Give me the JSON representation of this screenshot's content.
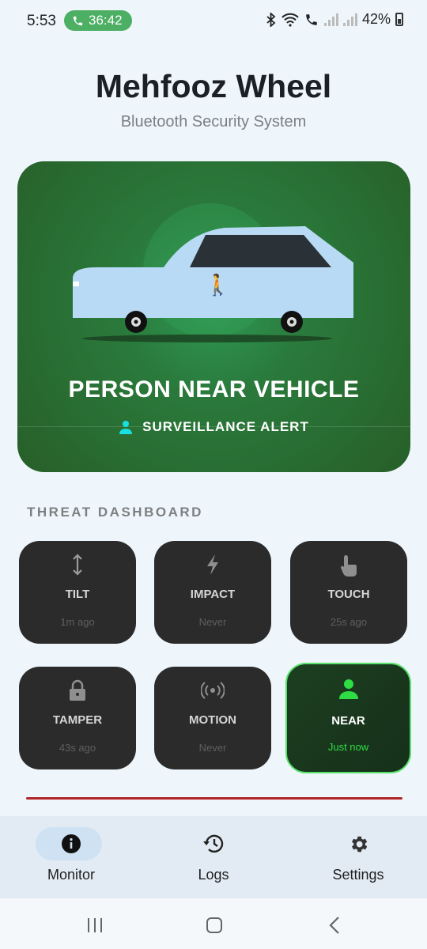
{
  "status_bar": {
    "time": "5:53",
    "call_timer": "36:42",
    "battery": "42%"
  },
  "header": {
    "title": "Mehfooz Wheel",
    "subtitle": "Bluetooth Security System"
  },
  "hero": {
    "alert_title": "PERSON NEAR VEHICLE",
    "alert_type": "SURVEILLANCE ALERT",
    "person_emoji": "🚶"
  },
  "dashboard": {
    "title": "THREAT DASHBOARD",
    "tiles": [
      {
        "icon": "tilt-arrows-icon",
        "label": "TILT",
        "time": "1m ago"
      },
      {
        "icon": "lightning-icon",
        "label": "IMPACT",
        "time": "Never"
      },
      {
        "icon": "touch-hand-icon",
        "label": "TOUCH",
        "time": "25s ago"
      },
      {
        "icon": "lock-icon",
        "label": "TAMPER",
        "time": "43s ago"
      },
      {
        "icon": "motion-waves-icon",
        "label": "MOTION",
        "time": "Never"
      },
      {
        "icon": "person-icon",
        "label": "NEAR",
        "time": "Just now"
      }
    ]
  },
  "bottom_nav": {
    "items": [
      {
        "icon": "info-icon",
        "label": "Monitor"
      },
      {
        "icon": "history-icon",
        "label": "Logs"
      },
      {
        "icon": "gear-icon",
        "label": "Settings"
      }
    ]
  },
  "colors": {
    "hero_green": "#2a7a3c",
    "active_green": "#2fdc44",
    "accent_cyan": "#19e0e0",
    "alert_red": "#b22424"
  }
}
